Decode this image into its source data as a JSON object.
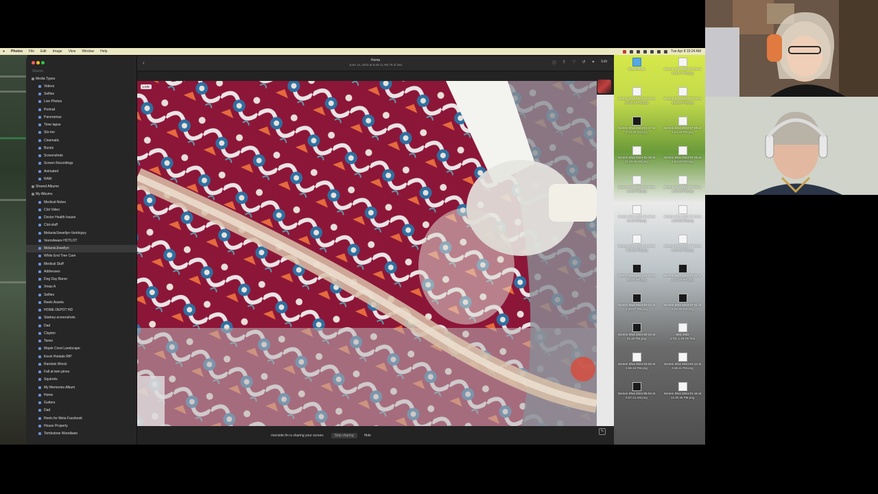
{
  "menubar": {
    "app": "Photos",
    "items": [
      "File",
      "Edit",
      "Image",
      "View",
      "Window",
      "Help"
    ],
    "clock": "Tue Apr 8  10:24 AM"
  },
  "sidebar": {
    "section_label": "Sharon",
    "items": [
      {
        "label": "Media Types",
        "group": true
      },
      {
        "label": "Videos"
      },
      {
        "label": "Selfies"
      },
      {
        "label": "Live Photos"
      },
      {
        "label": "Portrait"
      },
      {
        "label": "Panoramas"
      },
      {
        "label": "Time-lapse"
      },
      {
        "label": "Slo-mo"
      },
      {
        "label": "Cinematic"
      },
      {
        "label": "Bursts"
      },
      {
        "label": "Screenshots"
      },
      {
        "label": "Screen Recordings"
      },
      {
        "label": "Animated"
      },
      {
        "label": "RAW"
      },
      {
        "label": "Shared Albums",
        "group": true
      },
      {
        "label": "My Albums",
        "group": true
      },
      {
        "label": "Medical-Notes"
      },
      {
        "label": "Clot Video"
      },
      {
        "label": "Doctor Health Issues"
      },
      {
        "label": "Clot-stuff"
      },
      {
        "label": "Melanie/Jewellyn-VeinInjury"
      },
      {
        "label": "VeersAware HOTLOT"
      },
      {
        "label": "MelanieJewellyn",
        "selected": true
      },
      {
        "label": "Whits End Tree Care"
      },
      {
        "label": "Medical Stuff"
      },
      {
        "label": "Addresses"
      },
      {
        "label": "Dog Day Baron"
      },
      {
        "label": "Xmas A"
      },
      {
        "label": "Selfies"
      },
      {
        "label": "Reels Assets"
      },
      {
        "label": "HOME DEPOT HD"
      },
      {
        "label": "Starkey-screenshots"
      },
      {
        "label": "Dad"
      },
      {
        "label": "Clayton"
      },
      {
        "label": "Taxes"
      },
      {
        "label": "Maple Crest Landscape"
      },
      {
        "label": "Kevin Hoidale RIP"
      },
      {
        "label": "Randals Wreck"
      },
      {
        "label": "Fall at twin pines"
      },
      {
        "label": "Squirrels"
      },
      {
        "label": "My Memories Album"
      },
      {
        "label": "Home"
      },
      {
        "label": "Gutters"
      },
      {
        "label": "Dad"
      },
      {
        "label": "Reels for Meta Facebook"
      },
      {
        "label": "House Property"
      },
      {
        "label": "Tombstone Woodlawn"
      }
    ]
  },
  "toolbar": {
    "title": "Home",
    "subtitle": "June 14, 2023 at 8:45:11 AM     79 of 184",
    "edit_label": "Edit"
  },
  "photo": {
    "live_badge": "LIVE"
  },
  "share_notice": {
    "text": "riverside.fm is sharing your screen.",
    "stop_label": "Stop sharing",
    "hide_label": "Hide"
  },
  "desktop": {
    "icons": [
      {
        "name": "Screenshots",
        "sub": "",
        "kind": "folder"
      },
      {
        "name": "Screen Shot 2023-07-29 at",
        "sub": "1.51.47 PM.png",
        "kind": "shot"
      },
      {
        "name": "Screen Shot 2024-01-10 at",
        "sub": "10.50.33 AM.png",
        "kind": "shot"
      },
      {
        "name": "Screen Shot 2023-07-29 at",
        "sub": "1.52.10 PM.png",
        "kind": "shot"
      },
      {
        "name": "Screen Shot 2024-01-17 at",
        "sub": "9.12.40 AM.png",
        "kind": "dark"
      },
      {
        "name": "Screen Shot 2023-07-29 at",
        "sub": "1.53.20 PM.png",
        "kind": "shot"
      },
      {
        "name": "Screen Shot 2024-01-19 at",
        "sub": "11.20.05 AM.png",
        "kind": "shot"
      },
      {
        "name": "Screen Shot 2023-07-29 at",
        "sub": "1.53.55 PM.png",
        "kind": "shot"
      },
      {
        "name": "Screen Shot 2024-01-26 at",
        "sub": "12.43 PM.png",
        "kind": "shot"
      },
      {
        "name": "Screen Shot 2023-07-29 at",
        "sub": "1.54.23 PM.png",
        "kind": "shot"
      },
      {
        "name": "Screen Shot 2024-01-26 at",
        "sub": "12.43 PM.png",
        "kind": "shot"
      },
      {
        "name": "Screen Shot 2023-07-29 at",
        "sub": "1.54.39 PM.png",
        "kind": "shot"
      },
      {
        "name": "Screen Shot 2024-01-28 at",
        "sub": "7.33.32 PM.png",
        "kind": "shot"
      },
      {
        "name": "Screen Shot 2023-07-29 at",
        "sub": "3.49.48 PM.png",
        "kind": "shot"
      },
      {
        "name": "Screen Shot 2024-01-30 at",
        "sub": "20.40 PM.png",
        "kind": "dark"
      },
      {
        "name": "Screen Shot 2023-07-31 at",
        "sub": "2.44.35 PM.png",
        "kind": "dark"
      },
      {
        "name": "Screen Shot 2024-02-24 at",
        "sub": "2.28.07 PM.png",
        "kind": "dark"
      },
      {
        "name": "Screen Shot 2023-07-31 at",
        "sub": "6.09.30 PM.png",
        "kind": "dark"
      },
      {
        "name": "Screen Shot 2024-02-24 at",
        "sub": "21.40 PM.png",
        "kind": "dark"
      },
      {
        "name": "Mac SSD",
        "sub": "4 TB, 1.25 TB free",
        "kind": "shot"
      },
      {
        "name": "Screen Shot 2024-03-02 at",
        "sub": "2.59.15 PM.png",
        "kind": "shot"
      },
      {
        "name": "Screen Shot 2024-01-14 at",
        "sub": "4.06.11 PM.png",
        "kind": "shot"
      },
      {
        "name": "Screen Shot 2024-05-04 at",
        "sub": "6.57.21 AM.png",
        "kind": "dark"
      },
      {
        "name": "Screen Shot 2024-01-15 at",
        "sub": "12.30.45 PM.png",
        "kind": "shot"
      }
    ]
  }
}
